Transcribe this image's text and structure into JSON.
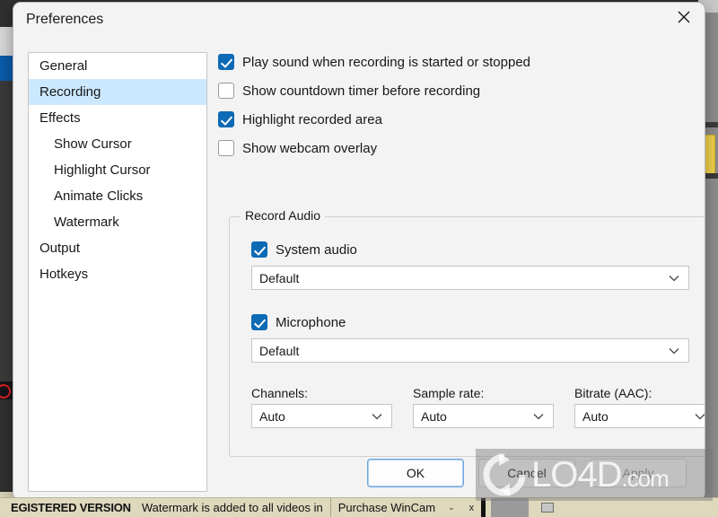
{
  "dialog": {
    "title": "Preferences",
    "close_icon": "close-icon"
  },
  "sidebar": {
    "items": [
      {
        "label": "General",
        "indent": false,
        "selected": false
      },
      {
        "label": "Recording",
        "indent": false,
        "selected": true
      },
      {
        "label": "Effects",
        "indent": false,
        "selected": false
      },
      {
        "label": "Show Cursor",
        "indent": true,
        "selected": false
      },
      {
        "label": "Highlight Cursor",
        "indent": true,
        "selected": false
      },
      {
        "label": "Animate Clicks",
        "indent": true,
        "selected": false
      },
      {
        "label": "Watermark",
        "indent": true,
        "selected": false
      },
      {
        "label": "Output",
        "indent": false,
        "selected": false
      },
      {
        "label": "Hotkeys",
        "indent": false,
        "selected": false
      }
    ]
  },
  "recording": {
    "checkboxes": [
      {
        "label": "Play sound when recording is started or stopped",
        "checked": true
      },
      {
        "label": "Show countdown timer before recording",
        "checked": false
      },
      {
        "label": "Highlight recorded area",
        "checked": true
      },
      {
        "label": "Show webcam overlay",
        "checked": false
      }
    ],
    "record_audio": {
      "legend": "Record Audio",
      "system_audio": {
        "label": "System audio",
        "checked": true,
        "device": "Default"
      },
      "microphone": {
        "label": "Microphone",
        "checked": true,
        "device": "Default"
      },
      "channels": {
        "label": "Channels:",
        "value": "Auto"
      },
      "sample_rate": {
        "label": "Sample rate:",
        "value": "Auto"
      },
      "bitrate": {
        "label": "Bitrate (AAC):",
        "value": "Auto"
      }
    }
  },
  "footer": {
    "ok": "OK",
    "cancel": "Cancel",
    "apply": "Apply"
  },
  "status_bar": {
    "registered": "EGISTERED VERSION",
    "note": "Watermark is added to all videos in",
    "purchase": "Purchase WinCam",
    "caret": "⌄",
    "close": "x"
  },
  "watermark": {
    "brand": "LO4D",
    "suffix": ".com"
  },
  "colors": {
    "accent_checkbox": "#0d6ab5",
    "selection": "#cce8ff",
    "focus_border": "#6ba7dd",
    "dialog_bg": "#f3f3f3",
    "status_bar_bg": "#ded8bd"
  }
}
